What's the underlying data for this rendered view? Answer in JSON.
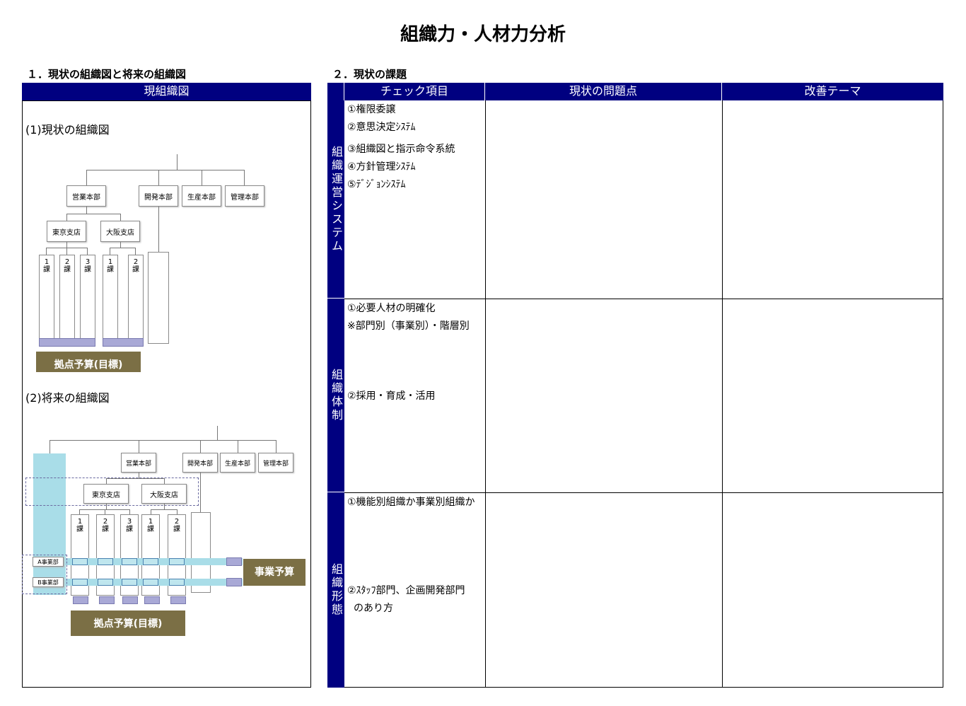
{
  "title": "組織力・人材力分析",
  "section1_title": "１．現状の組織図と将来の組織図",
  "section2_title": "２．現状の課題",
  "left_panel": {
    "header": "現組織図",
    "current_label": "(1)現状の組織図",
    "future_label": "(2)将来の組織図",
    "departments": [
      "営業本部",
      "開発本部",
      "生産本部",
      "管理本部"
    ],
    "branches": [
      "東京支店",
      "大阪支店"
    ],
    "sections": [
      "1課",
      "2課",
      "3課",
      "1課",
      "2課"
    ],
    "budget_label": "拠点予算(目標)",
    "business_budget_label": "事業予算",
    "business_divisions": [
      "A事業部",
      "B事業部"
    ]
  },
  "table": {
    "headers": [
      "チェック項目",
      "現状の問題点",
      "改善テーマ"
    ],
    "groups": [
      {
        "label": "組織運営システム",
        "items": [
          "①権限委譲",
          "②意思決定ｼｽﾃﾑ",
          "③組織図と指示命令系統",
          "④方針管理ｼｽﾃﾑ",
          "⑤ﾃﾞｼﾞｮﾝｼｽﾃﾑ"
        ]
      },
      {
        "label": "組織体制",
        "items": [
          "①必要人材の明確化",
          "※部門別（事業別）・階層別",
          "②採用・育成・活用"
        ]
      },
      {
        "label": "組織形態",
        "items": [
          "①機能別組織か事業別組織か",
          "②ｽﾀｯﾌ部門、企画開発部門",
          "のあり方"
        ]
      }
    ]
  },
  "colors": {
    "header_navy": "#000080",
    "budget_olive": "#7b6f45",
    "highlight_cyan": "#a9dde8"
  }
}
